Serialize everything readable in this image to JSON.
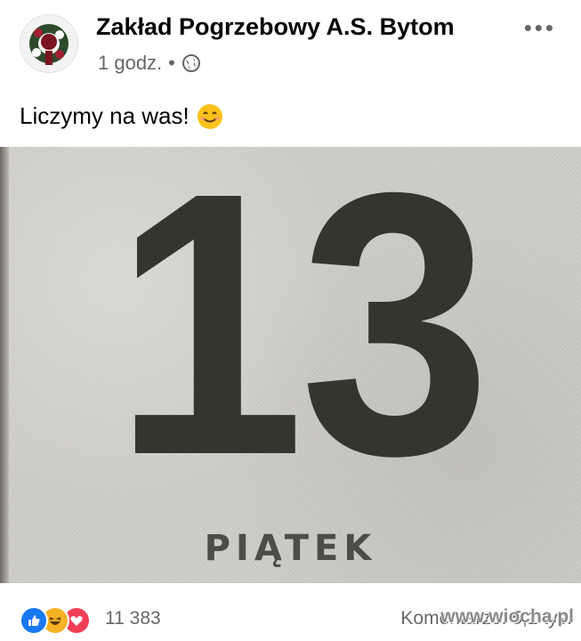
{
  "post": {
    "page_name": "Zakład Pogrzebowy A.S. Bytom",
    "time": "1 godz.",
    "separator": "•",
    "caption": "Liczymy na was!",
    "more_label": "•••"
  },
  "image": {
    "number": "13",
    "day": "PIĄTEK"
  },
  "reactions": {
    "count": "11 383",
    "comments": "Komentarze: 5,1 tys.",
    "icons": [
      "like-icon",
      "haha-icon",
      "love-icon"
    ]
  },
  "watermark": "www.wiocha.pl",
  "colors": {
    "like": "#1877f2",
    "haha": "#f7b125",
    "love": "#f33e58"
  }
}
